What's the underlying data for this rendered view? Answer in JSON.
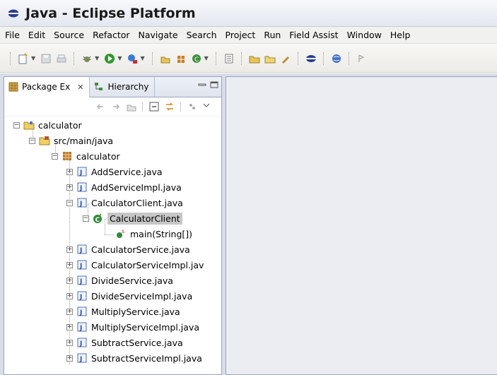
{
  "window": {
    "title": "Java - Eclipse Platform"
  },
  "menu": [
    "File",
    "Edit",
    "Source",
    "Refactor",
    "Navigate",
    "Search",
    "Project",
    "Run",
    "Field Assist",
    "Window",
    "Help"
  ],
  "views": {
    "tabs": [
      {
        "label": "Package Ex",
        "icon": "package-explorer-icon",
        "active": true
      },
      {
        "label": "Hierarchy",
        "icon": "hierarchy-icon",
        "active": false
      }
    ]
  },
  "tree": {
    "project": "calculator",
    "source_folder": "src/main/java",
    "package": "calculator",
    "files": [
      "AddService.java",
      "AddServiceImpl.java",
      "CalculatorClient.java",
      "CalculatorService.java",
      "CalculatorServiceImpl.jav",
      "DivideService.java",
      "DivideServiceImpl.java",
      "MultiplyService.java",
      "MultiplyServiceImpl.java",
      "SubtractService.java",
      "SubtractServiceImpl.java"
    ],
    "class_node": "CalculatorClient",
    "method_node": "main(String[])"
  },
  "colors": {
    "selection": "#c7c7c7",
    "workbench_bg": "#d9dde8",
    "view_border": "#9aa4b8"
  }
}
